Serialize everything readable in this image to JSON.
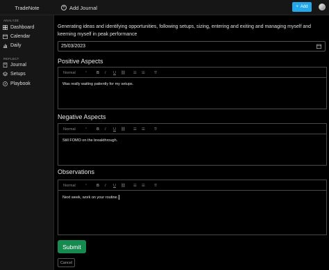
{
  "header": {
    "brand": "TradeNote",
    "add_journal_label": "Add Journal",
    "add_button_label": "Add"
  },
  "sidebar": {
    "sections": [
      {
        "label": "ANALYZE",
        "items": [
          {
            "label": "Dashboard",
            "icon": "dashboard-icon"
          },
          {
            "label": "Calendar",
            "icon": "calendar-icon"
          },
          {
            "label": "Daily",
            "icon": "bar-chart-icon"
          }
        ]
      },
      {
        "label": "REFLECT",
        "items": [
          {
            "label": "Journal",
            "icon": "journal-icon"
          },
          {
            "label": "Setups",
            "icon": "layers-icon"
          },
          {
            "label": "Playbook",
            "icon": "compass-icon"
          }
        ]
      }
    ]
  },
  "form": {
    "intro": "Generating ideas and identifying opportunities, following setups, sizing, entering and exiting and managing myself and keeming myself in peak performance",
    "date_value": "25/03/2023",
    "toolbar": {
      "heading_select": "Normal"
    },
    "sections": [
      {
        "title": "Positive Aspects",
        "content": "Was really waiting patiently for my setups."
      },
      {
        "title": "Negative Aspects",
        "content": "Still FOMO on the breakthrough."
      },
      {
        "title": "Observations",
        "content": "Next week, work on your routine."
      }
    ],
    "submit_label": "Submit",
    "cancel_label": "Cancel"
  },
  "colors": {
    "accent_blue": "#24a8ea",
    "submit_green": "#178a4f",
    "background": "#000000",
    "sidebar": "#161616"
  }
}
